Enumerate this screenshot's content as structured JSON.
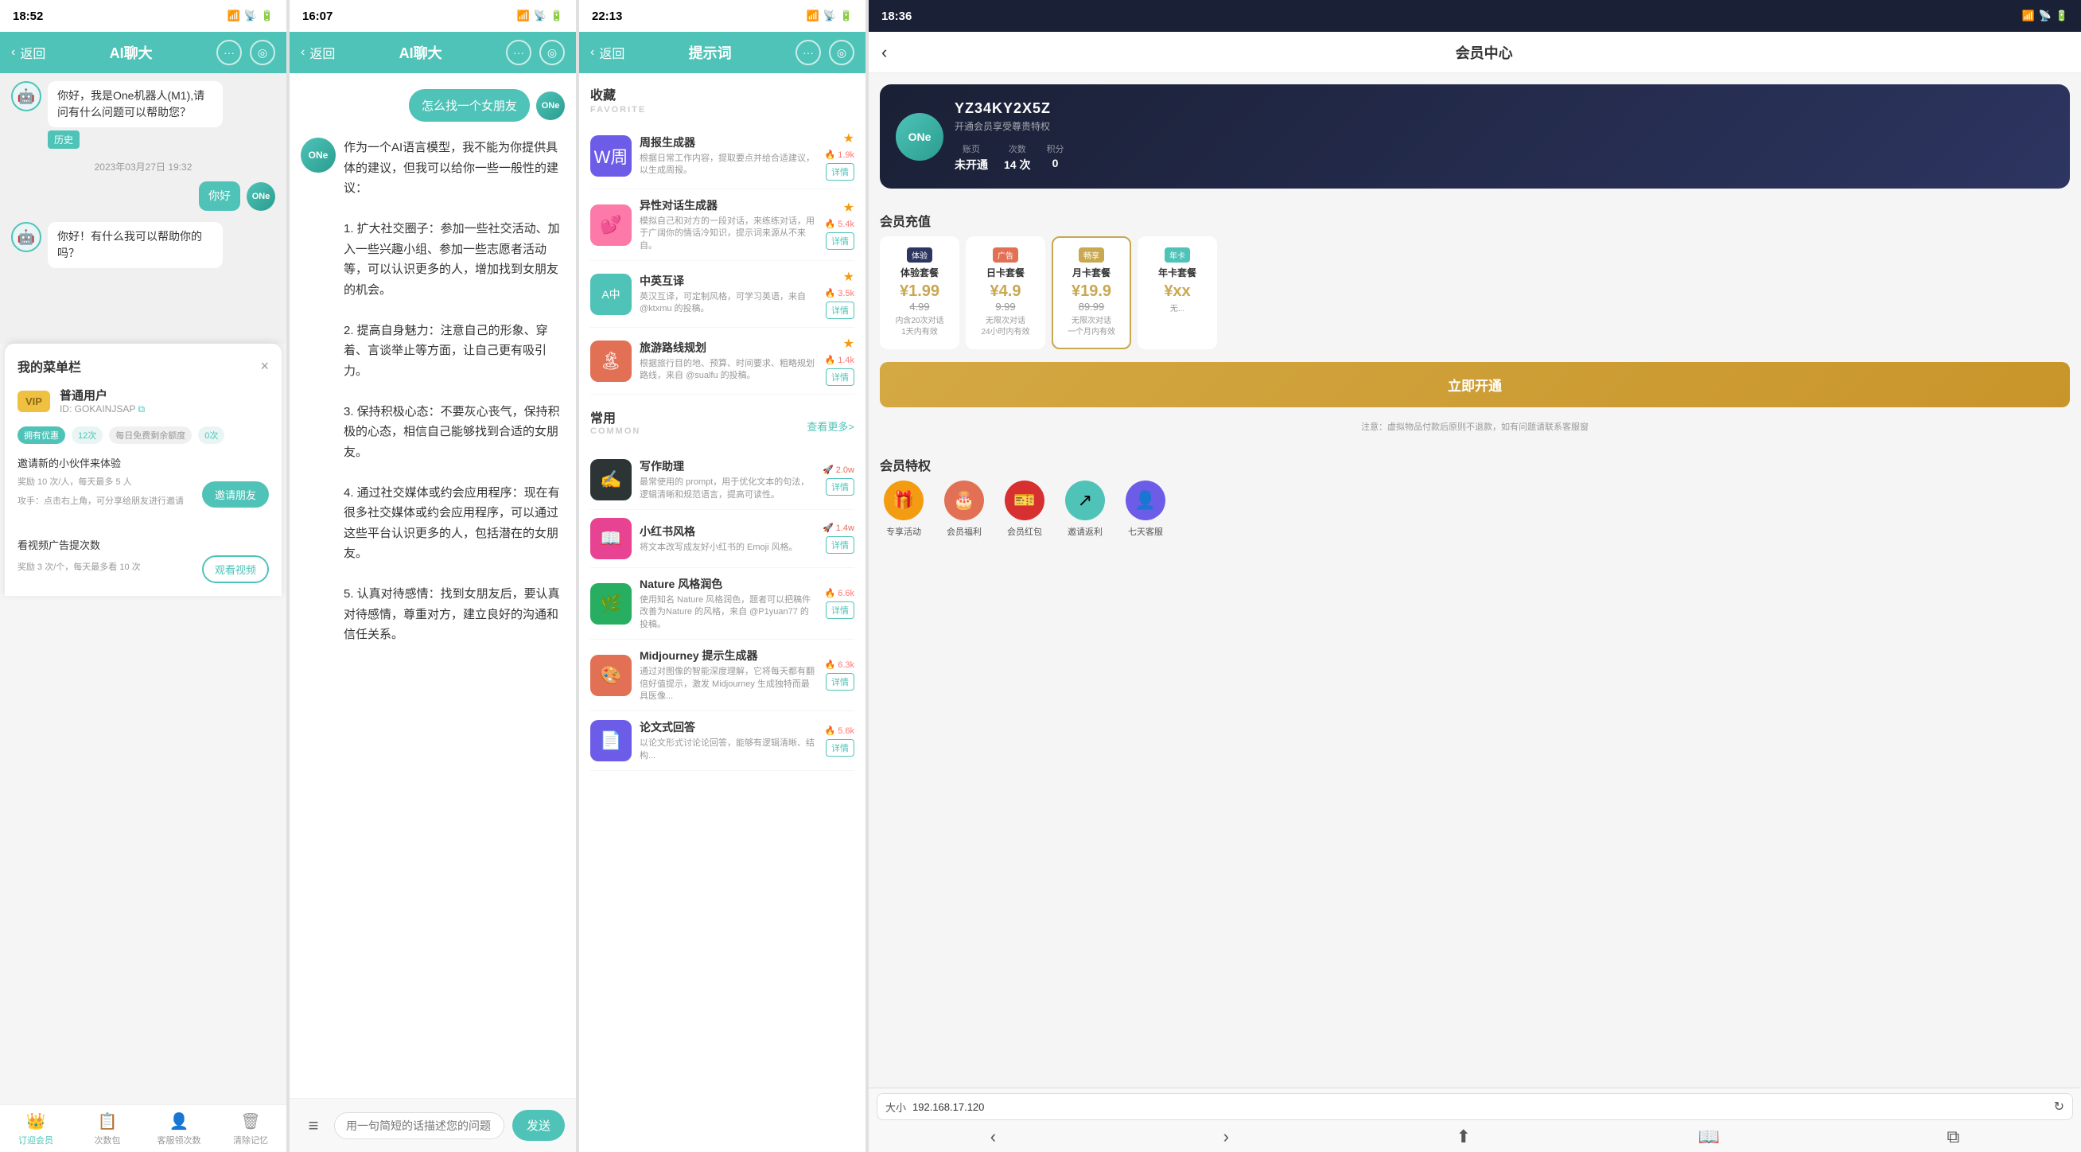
{
  "panel1": {
    "status_time": "18:52",
    "nav_back": "返回",
    "nav_title": "AI聊大",
    "chat": {
      "bot_greeting": "你好，我是One机器人(M1),请问有什么问题可以帮助您？",
      "time_stamp": "2023年03月27日 19:32",
      "user_reply": "你好",
      "hist_label": "历史",
      "bot_reply": "你好！有什么我可以帮助你的吗？"
    },
    "menu": {
      "title": "我的菜单栏",
      "close": "×",
      "vip_label": "VIP",
      "user_name": "普通用户",
      "user_id": "ID: GOKAINJSAP",
      "tag_youhui": "拥有优惠",
      "tag_count": "12次",
      "tag_daily": "每日免费剩余额度",
      "tag_daily_count": "0次",
      "invite_label": "邀请新的小伙伴来体验",
      "invite_sub": "奖励 10 次/人，每天最多 5 人",
      "invite_sub2": "攻手：点击右上角，可分享给朋友进行邀请",
      "invite_btn": "邀请朋友",
      "video_label": "看视频广告提次数",
      "video_sub": "奖励 3 次/个，每天最多看 10 次",
      "video_btn": "观看视频"
    },
    "bottom_nav": [
      {
        "label": "订迎会员",
        "icon": "👑"
      },
      {
        "label": "次数包",
        "icon": "📋"
      },
      {
        "label": "客服领次数",
        "icon": "👤"
      },
      {
        "label": "清除记忆",
        "icon": "🗑"
      }
    ]
  },
  "panel2": {
    "status_time": "16:07",
    "nav_back": "返回",
    "nav_title": "AI聊大",
    "prompt": "怎么找一个女朋友",
    "one_label": "ONe",
    "response": "作为一个AI语言模型，我不能为你提供具体的建议，但我可以给你一些一般性的建议：\n\n1. 扩大社交圈子：参加一些社交活动、加入一些兴趣小组、参加一些志愿者活动等，可以认识更多的人，增加找到女朋友的机会。\n\n2. 提高自身魅力：注意自己的形象、穿着、言谈举止等方面，让自己更有吸引力。\n\n3. 保持积极心态：不要灰心丧气，保持积极的心态，相信自己能够找到合适的女朋友。\n\n4. 通过社交媒体或约会应用程序：现在有很多社交媒体或约会应用程序，可以通过这些平台认识更多的人，包括潜在的女朋友。\n\n5. 认真对待感情：找到女朋友后，要认真对待感情，尊重对方，建立良好的沟通和信任关系。",
    "input_placeholder": "用一句简短的话描述您的问题",
    "send_btn": "发送"
  },
  "panel3": {
    "status_time": "22:13",
    "nav_back": "返回",
    "nav_title": "提示词",
    "sections": {
      "favorites_label": "收藏",
      "favorites_sub": "FAVORITE",
      "common_label": "常用",
      "common_sub": "COMMON",
      "see_more": "查看更多>"
    },
    "favorites": [
      {
        "icon": "W周",
        "icon_type": "purple",
        "title": "周报生成器",
        "desc": "根据日常工作内容，提取要点并给合适建议，以生成周报。",
        "count": "🔥 1.9k",
        "detail": "详情"
      },
      {
        "icon": "💕",
        "icon_type": "pink",
        "title": "异性对话生成器",
        "desc": "模拟自己和对方的一段对话，来练练对话，用于广阔你的情话冷知识，提示词来源从不来自。",
        "count": "🔥 5.4k",
        "detail": "详情"
      },
      {
        "icon": "A中",
        "icon_type": "teal",
        "title": "中英互译",
        "desc": "英汉互译，可定制风格，可学习英语，来自@ktxmu 的投稿。",
        "count": "🔥 3.5k",
        "detail": "详情"
      },
      {
        "icon": "🏝",
        "icon_type": "orange",
        "title": "旅游路线规划",
        "desc": "根据旅行目的地、预算、时间要求、粗略规划路线，来自 @sualfu 的投稿。",
        "count": "🔥 1.4k",
        "detail": "详情"
      }
    ],
    "common": [
      {
        "icon": "✍",
        "icon_type": "dark",
        "title": "写作助理",
        "desc": "最常使用的 prompt，用于优化文本的句法，逻辑清晰和规范语言，提高可读性。",
        "count": "🚀 2.0w",
        "detail": "详情"
      },
      {
        "icon": "📖",
        "icon_type": "green",
        "title": "小红书风格",
        "desc": "将文本改写成友好小红书的 Emoji 风格。",
        "count": "🚀 1.4w",
        "detail": "详情"
      },
      {
        "icon": "🌿",
        "icon_type": "nature",
        "title": "Nature 风格润色",
        "desc": "使用知名 Nature 风格润色，题者可以把稿件改善为Nature 的风格，来自 @P1yuan77 的投稿。",
        "count": "🔥 6.6k",
        "detail": "详情"
      },
      {
        "icon": "🎨",
        "icon_type": "mj",
        "title": "Midjourney 提示生成器",
        "desc": "通过对图像的智能深度理解，它将每天都有翻倍好值提示，激发 Midjourney 生成独特而最具医像...",
        "count": "🔥 6.3k",
        "detail": "详情"
      },
      {
        "icon": "📄",
        "icon_type": "doc",
        "title": "论文式回答",
        "desc": "以论文形式讨论论回答，能够有逻辑清晰、结构...",
        "count": "🔥 5.6k",
        "detail": "详情"
      }
    ]
  },
  "panel4": {
    "status_time": "18:36",
    "nav_back": "‹",
    "nav_title": "会员中心",
    "member": {
      "code": "YZ34KY2X5Z",
      "logo": "ONe",
      "desc": "开通会员享受尊贵特权",
      "stats": [
        {
          "label": "账页",
          "value": "未开通"
        },
        {
          "label": "次数",
          "value": "14 次"
        },
        {
          "label": "积分",
          "value": "0"
        }
      ]
    },
    "recharge_title": "会员充值",
    "recharge_plans": [
      {
        "tag": "体验",
        "type": "体验套餐",
        "price": "¥1.99",
        "old_price": "4.99",
        "desc": "内含20次对话\n1天内有效",
        "selected": false
      },
      {
        "tag": "广告",
        "type": "日卡套餐",
        "price": "¥4.9",
        "old_price": "9.99",
        "desc": "无限次对话\n24小时内有效",
        "selected": false
      },
      {
        "tag": "畅享",
        "type": "月卡套餐",
        "price": "¥19.9",
        "old_price": "89.99",
        "desc": "无限次对话\n一个月内有效",
        "selected": true
      },
      {
        "tag": "年卡",
        "type": "年卡套餐",
        "price": "¥xx",
        "old_price": "",
        "desc": "无...",
        "selected": false
      }
    ],
    "open_btn": "立即开通",
    "note": "注意：虚拟物品付款后原则不退款，如有问题请联系客服窗",
    "privilege_title": "会员特权",
    "privileges": [
      {
        "icon": "🎁",
        "label": "专享活动",
        "bg": "#f39c12"
      },
      {
        "icon": "🎂",
        "label": "会员福利",
        "bg": "#e17055"
      },
      {
        "icon": "🎫",
        "label": "会员红包",
        "bg": "#d63031"
      },
      {
        "icon": "↗",
        "label": "邀请返利",
        "bg": "#4fc3b8"
      },
      {
        "icon": "👤",
        "label": "七天客服",
        "bg": "#6c5ce7"
      }
    ],
    "browser": {
      "url": "192.168.17.120",
      "size_label": "大小"
    }
  }
}
